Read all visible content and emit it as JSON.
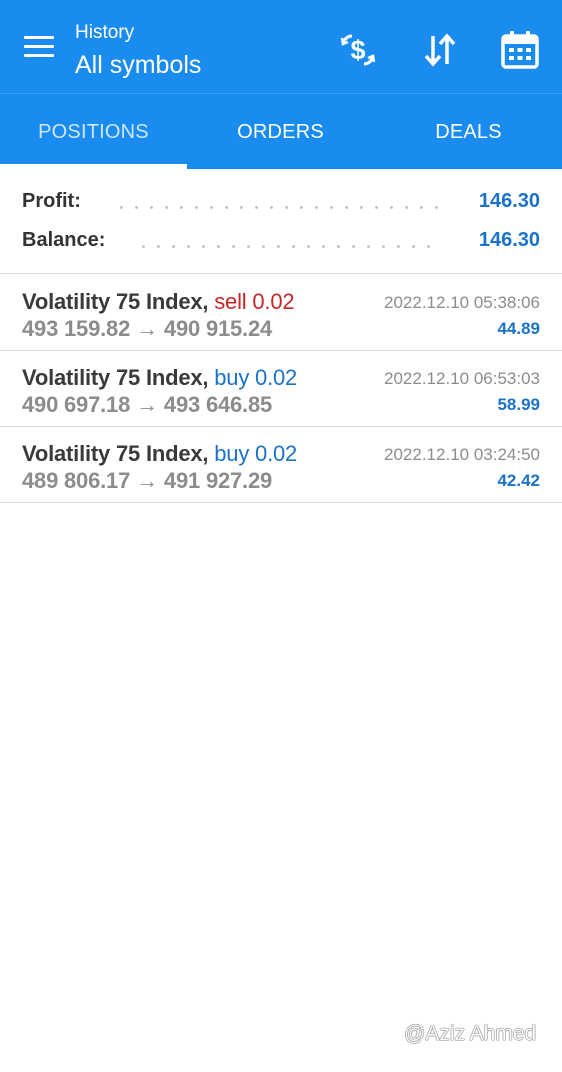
{
  "header": {
    "subtitle": "History",
    "title": "All symbols",
    "accent_color": "#1a8cf0",
    "actions": [
      {
        "icon": "currency-exchange-icon"
      },
      {
        "icon": "sort-icon"
      },
      {
        "icon": "calendar-icon"
      }
    ]
  },
  "tabs": [
    {
      "label": "POSITIONS",
      "active": true
    },
    {
      "label": "ORDERS",
      "active": false
    },
    {
      "label": "DEALS",
      "active": false
    }
  ],
  "summary": {
    "profit_label": "Profit:",
    "profit_value": "146.30",
    "balance_label": "Balance:",
    "balance_value": "146.30"
  },
  "positions": [
    {
      "symbol": "Volatility 75 Index,",
      "type": "sell 0.02",
      "direction": "sell",
      "open_price": "493 159.82",
      "arrow": "→",
      "close_price": "490 915.24",
      "time": "2022.12.10 05:38:06",
      "profit": "44.89"
    },
    {
      "symbol": "Volatility 75 Index,",
      "type": "buy 0.02",
      "direction": "buy",
      "open_price": "490 697.18",
      "arrow": "→",
      "close_price": "493 646.85",
      "time": "2022.12.10 06:53:03",
      "profit": "58.99"
    },
    {
      "symbol": "Volatility 75 Index,",
      "type": "buy 0.02",
      "direction": "buy",
      "open_price": "489 806.17",
      "arrow": "→",
      "close_price": "491 927.29",
      "time": "2022.12.10 03:24:50",
      "profit": "42.42"
    }
  ],
  "watermark": "@Aziz Ahmed",
  "colors": {
    "sell": "#c62828",
    "buy": "#1a73c9",
    "profit": "#1a73c9"
  }
}
